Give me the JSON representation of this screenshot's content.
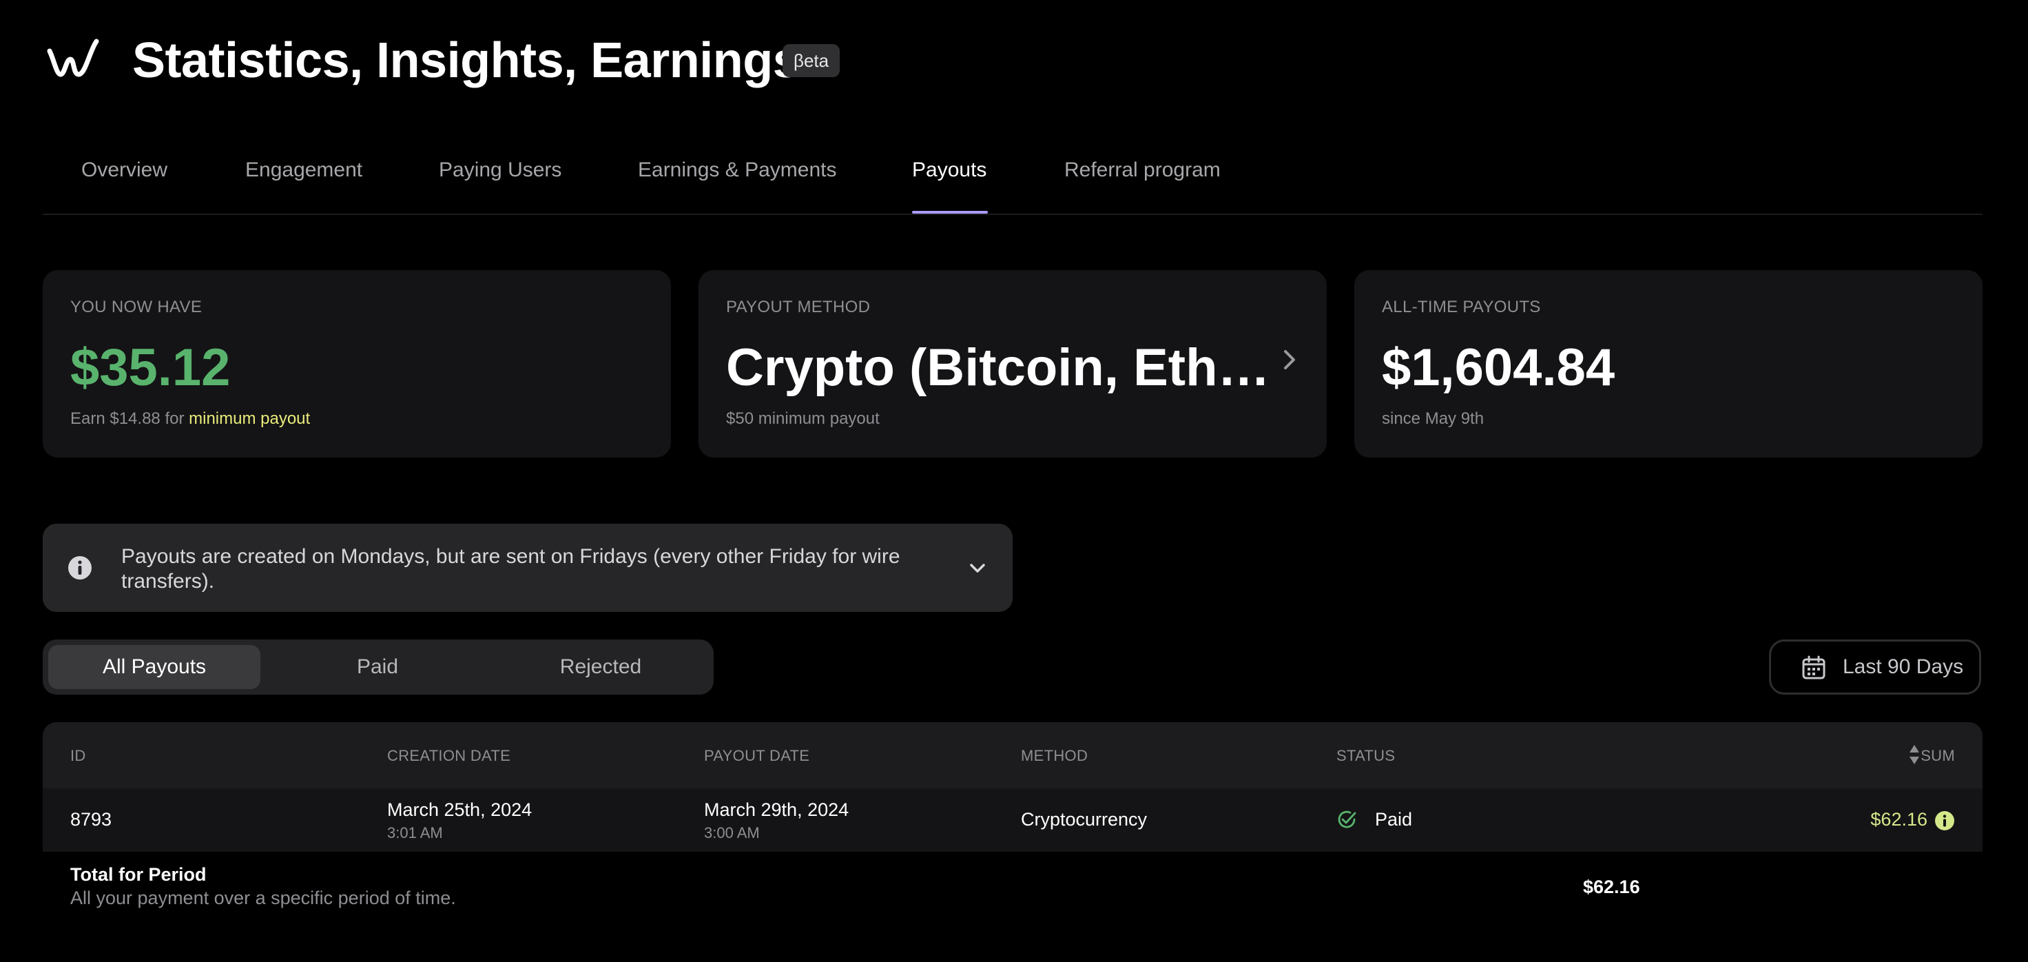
{
  "header": {
    "title": "Statistics, Insights, Earnings",
    "badge": "βeta"
  },
  "tabs": [
    {
      "label": "Overview"
    },
    {
      "label": "Engagement"
    },
    {
      "label": "Paying Users"
    },
    {
      "label": "Earnings & Payments"
    },
    {
      "label": "Payouts",
      "active": true
    },
    {
      "label": "Referral program"
    }
  ],
  "cards": {
    "balance": {
      "label": "YOU NOW HAVE",
      "value": "$35.12",
      "sub_prefix": "Earn $14.88 for",
      "sub_link": "minimum payout"
    },
    "method": {
      "label": "PAYOUT METHOD",
      "value": "Crypto (Bitcoin, Eth…",
      "sub": "$50 minimum payout"
    },
    "alltime": {
      "label": "ALL-TIME PAYOUTS",
      "value": "$1,604.84",
      "sub": "since May 9th"
    }
  },
  "notice": {
    "text": "Payouts are created on Mondays, but are sent on Fridays (every other Friday for wire transfers)."
  },
  "filters": {
    "segments": [
      {
        "label": "All Payouts",
        "active": true
      },
      {
        "label": "Paid"
      },
      {
        "label": "Rejected"
      }
    ],
    "range_label": "Last 90 Days"
  },
  "table": {
    "columns": [
      "ID",
      "CREATION DATE",
      "PAYOUT DATE",
      "METHOD",
      "STATUS",
      "SUM"
    ],
    "rows": [
      {
        "id": "8793",
        "created_date": "March 25th, 2024",
        "created_time": "3:01 AM",
        "payout_date": "March 29th, 2024",
        "payout_time": "3:00 AM",
        "method": "Cryptocurrency",
        "status": "Paid",
        "sum": "$62.16"
      }
    ]
  },
  "total": {
    "title": "Total for Period",
    "subtitle": "All your payment over a specific period of time.",
    "value": "$62.16"
  },
  "colors": {
    "accent": "#a99cff",
    "positive": "#59b36d",
    "highlight": "#e9ec7b",
    "sum_text": "#d4e88a"
  }
}
